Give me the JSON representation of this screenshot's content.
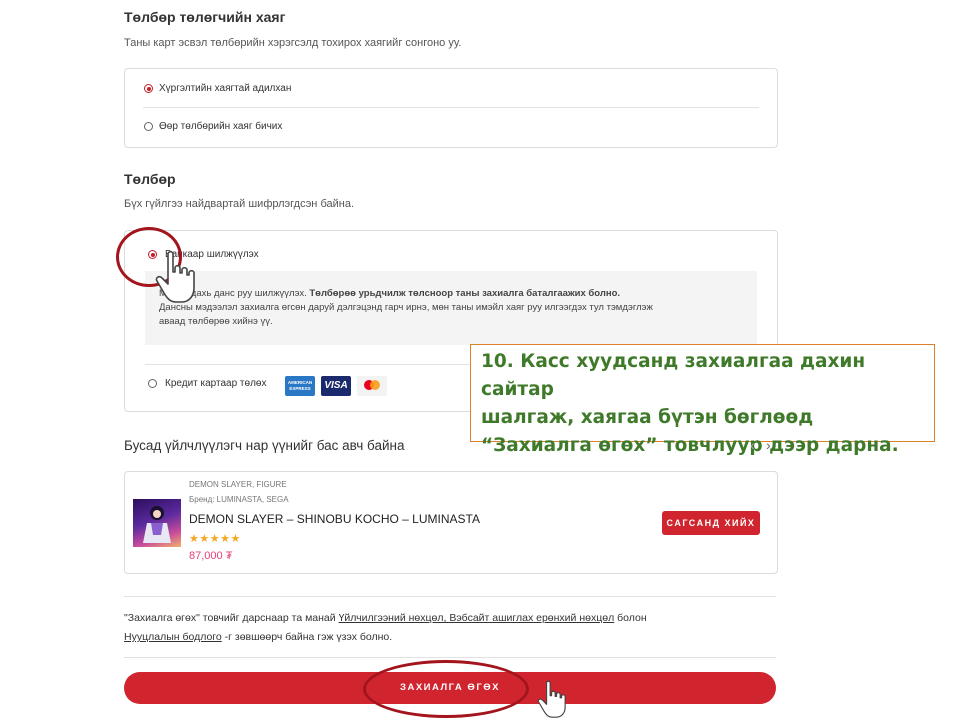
{
  "billing": {
    "title": "Төлбөр төлөгчийн хаяг",
    "subtitle": "Таны карт эсвэл төлбөрийн хэрэгсэлд тохирох хаягийг сонгоно уу.",
    "options": [
      "Хүргэлтийн хаягтай адилхан",
      "Өөр төлбөрийн хаяг бичих"
    ],
    "selected": 0
  },
  "payment": {
    "title": "Төлбөр",
    "subtitle": "Бүх гүйлгээ найдвартай шифрлэгдсэн байна.",
    "bank_option": "Банкаар шилжүүлэх",
    "info_line1_normal": "Манай дахь данс руу шилжүүлэх.",
    "info_line1_bold": "Төлбөрөө урьдчилж төлсноор таны захиалга баталгаажих болно.",
    "info_line2": "Дансны мэдээлэл захиалга өгсөн даруй дэлгэцэнд гарч ирнэ, мөн таны имэйл хаяг руу илгээгдэх тул тэмдэглэж",
    "info_line3": "аваад төлбөрөө хийнэ үү.",
    "card_option": "Кредит картаар төлөх",
    "card_icons": [
      "amex-card-icon",
      "visa-card-icon",
      "mastercard-icon"
    ],
    "amex_text": "AMERICAN EXPRESS",
    "visa_text": "VISA"
  },
  "callout": {
    "line1": "10. Касс хуудсанд захиалгаа дахин сайтар",
    "line2": "шалгаж, хаягаа бүтэн бөглөөд",
    "line3": "“Захиалга өгөх” товчлуур дээр дарна."
  },
  "related": {
    "title": "Бусад үйлчлүүлэгч нар үүнийг бас авч байна",
    "product": {
      "category": "DEMON SLAYER, FIGURE",
      "brand": "Бренд: LUMINASTA, SEGA",
      "name": "DEMON SLAYER – SHINOBU KOCHO – LUMINASTA",
      "stars": "★★★★★",
      "rating": 5,
      "price": "87,000 ₮",
      "add_button": "САГСАНД ХИЙХ"
    }
  },
  "terms": {
    "prefix": "\"Захиалга өгөх\" товчийг дарснаар та манай",
    "link1": "Үйлчилгээний нөхцөл, Вэбсайт ашиглах ерөнхий нөхцөл",
    "middle": "болон",
    "link2": "Нууцлалын бодлого",
    "suffix": "-г зөвшөөрч байна гэж үзэх болно."
  },
  "place_order_button": "ЗАХИАЛГА ӨГӨХ",
  "colors": {
    "accent_red": "#d0252f",
    "annotation_red": "#a3141c",
    "callout_green": "#3f7a2a",
    "callout_border": "#d9822b",
    "price_pink": "#e4407a",
    "star_gold": "#f5a623"
  }
}
